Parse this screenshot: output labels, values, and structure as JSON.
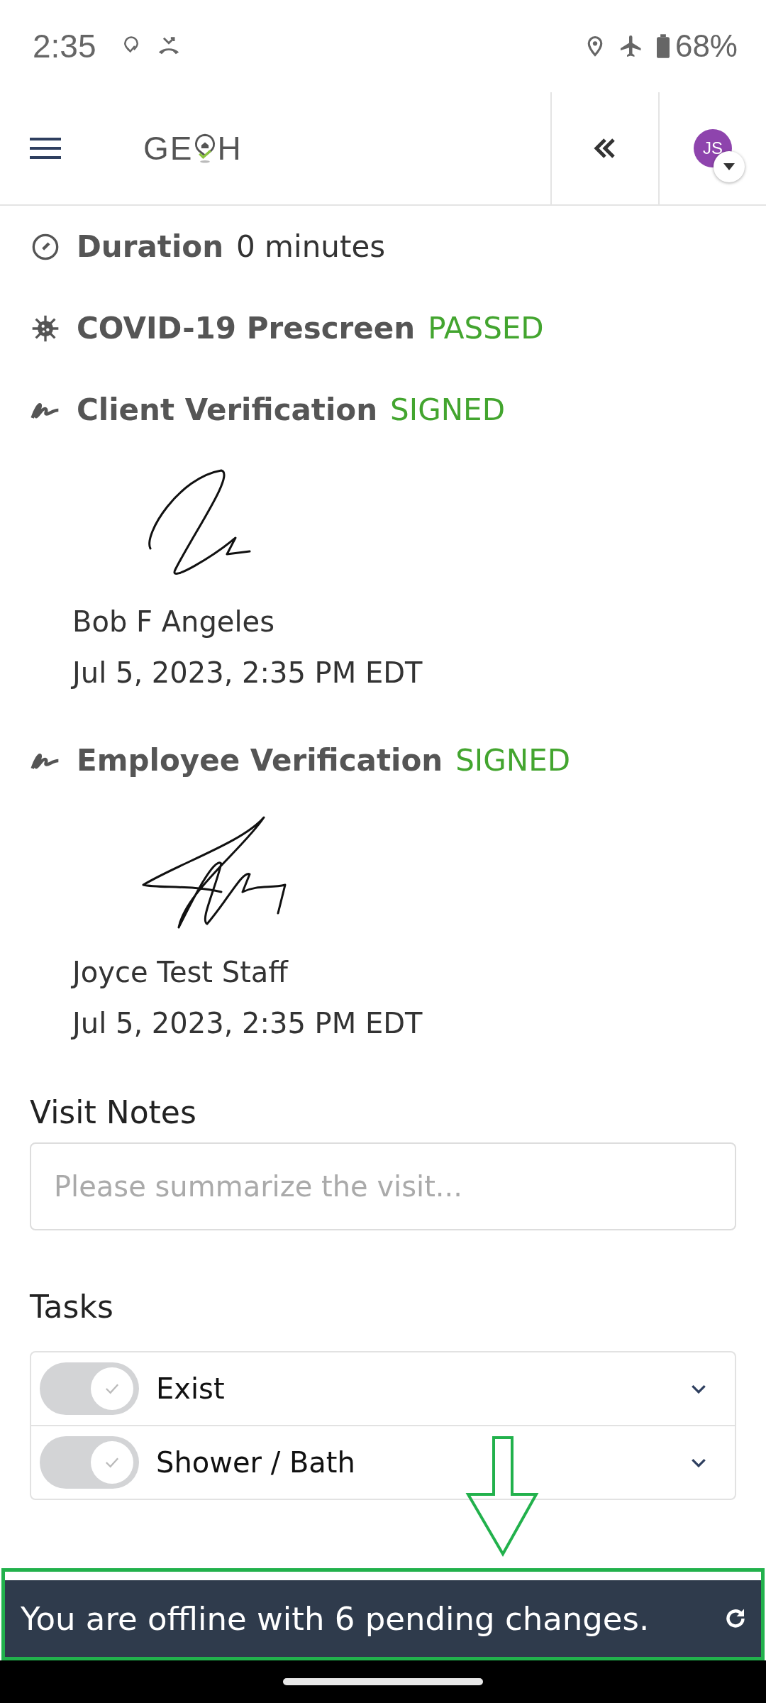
{
  "status_bar": {
    "time": "2:35",
    "battery": "68%"
  },
  "header": {
    "logo": [
      "GE",
      "H"
    ],
    "avatar": "JS"
  },
  "details": [
    {
      "kind": "duration",
      "label": "Duration",
      "value": "0 minutes",
      "color": "#333333"
    },
    {
      "kind": "covid",
      "label": "COVID-19 Prescreen",
      "value": "PASSED",
      "color": "#43a52f"
    },
    {
      "kind": "verification",
      "label": "Client Verification",
      "value": "SIGNED",
      "color": "#43a52f",
      "signer": "Bob F Angeles",
      "date": "Jul 5, 2023, 2:35 PM EDT"
    },
    {
      "kind": "verification",
      "label": "Employee Verification",
      "value": "SIGNED",
      "color": "#43a52f",
      "signer": "Joyce Test Staff",
      "date": "Jul 5, 2023, 2:35 PM EDT"
    }
  ],
  "visit_notes": {
    "title": "Visit Notes",
    "placeholder": "Please summarize the visit..."
  },
  "tasks": {
    "title": "Tasks",
    "items": [
      {
        "label": "Exist",
        "on": false
      },
      {
        "label": "Shower / Bath",
        "on": false
      }
    ]
  },
  "banner": {
    "message": "You are offline with 6 pending changes."
  }
}
